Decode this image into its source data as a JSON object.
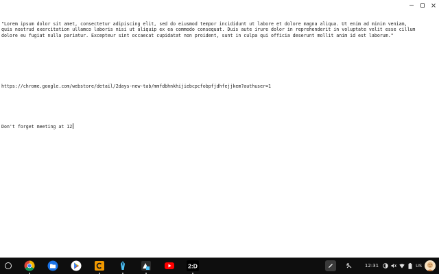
{
  "editor": {
    "paragraph_lorem": "\"Lorem ipsum dolor sit amet, consectetur adipiscing elit, sed do eiusmod tempor incididunt ut labore et dolore magna aliqua. Ut enim ad minim veniam, quis nostrud exercitation ullamco laboris nisi ut aliquip ex ea commodo consequat. Duis aute irure dolor in reprehenderit in voluptate velit esse cillum dolore eu fugiat nulla pariatur. Excepteur sint occaecat cupidatat non proident, sunt in culpa qui officia deserunt mollit anim id est laborum.\"",
    "url_line": "https://chrome.google.com/webstore/detail/2days-new-tab/mmfdbhnkhijiebcpcfobpfjdhfejjkem?authuser=1",
    "note_line": "Don't forget meeting at 12"
  },
  "window_controls": {
    "icons": [
      "minimize-icon",
      "maximize-icon",
      "close-icon"
    ]
  },
  "shelf": {
    "launcher_icon": "launcher-circle-icon",
    "apps": [
      {
        "name": "Chrome",
        "icon": "chrome-icon",
        "running": true
      },
      {
        "name": "Files",
        "icon": "files-icon",
        "running": false
      },
      {
        "name": "Play Store",
        "icon": "play-store-icon",
        "running": false
      },
      {
        "name": "App C",
        "icon": "orange-c-icon",
        "running": true
      },
      {
        "name": "Pen app",
        "icon": "pen-app-icon",
        "running": true
      },
      {
        "name": "Shape app",
        "icon": "shape-app-icon",
        "running": true
      },
      {
        "name": "YouTube",
        "icon": "youtube-icon",
        "running": false
      },
      {
        "name": "2D app",
        "icon": "2d-icon",
        "label": "2:D",
        "running": true
      }
    ],
    "tray": {
      "stylus_icon": "stylus-icon",
      "clipboard_icon": "screen-capture-icon",
      "time": "12:31",
      "status_icons": [
        "dnd-icon",
        "volume-icon",
        "wifi-icon",
        "battery-icon"
      ],
      "ime": "US",
      "avatar_icon": "user-avatar-icon"
    },
    "colors": {
      "shelf_bg": "#0e0e0e",
      "chrome_red": "#db4437",
      "chrome_yellow": "#f4b400",
      "chrome_green": "#0f9d58",
      "chrome_blue": "#4285f4",
      "files_blue": "#1a73e8",
      "orange": "#f29900",
      "youtube_red": "#ff0000"
    }
  }
}
